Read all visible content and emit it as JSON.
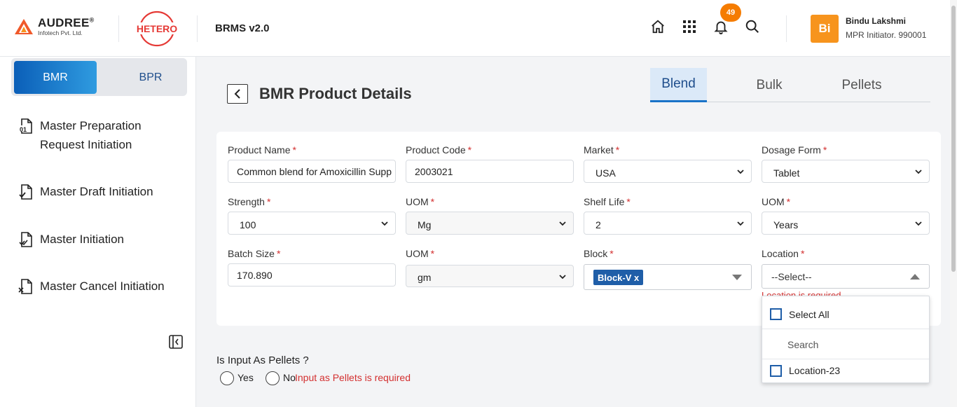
{
  "header": {
    "brand_name": "AUDREE",
    "brand_reg": "®",
    "brand_sub": "Infotech Pvt. Ltd.",
    "partner_logo": "HETERO",
    "app_title": "BRMS v2.0",
    "notification_count": "49",
    "user": {
      "initials": "Bi",
      "name": "Bindu Lakshmi",
      "role": "MPR Initiator. 990001"
    },
    "icons": [
      "home-icon",
      "apps-grid-icon",
      "bell-icon",
      "search-icon"
    ]
  },
  "sidebar": {
    "toggle": {
      "active": "BMR",
      "inactive": "BPR"
    },
    "items": [
      {
        "label_line1": "Master Preparation",
        "label_line2": "Request Initiation",
        "icon": "file-01-icon"
      },
      {
        "label": "Master Draft Initiation",
        "icon": "file-check-icon"
      },
      {
        "label": "Master Initiation",
        "icon": "file-double-check-icon"
      },
      {
        "label": "Master Cancel Initiation",
        "icon": "file-x-icon"
      }
    ]
  },
  "main": {
    "title": "BMR Product Details",
    "tabs": [
      {
        "label": "Blend",
        "active": true
      },
      {
        "label": "Bulk",
        "active": false
      },
      {
        "label": "Pellets",
        "active": false
      }
    ],
    "form": {
      "product_name": {
        "label": "Product Name",
        "value": "Common blend for Amoxicillin Supp"
      },
      "product_code": {
        "label": "Product Code",
        "value": "2003021"
      },
      "market": {
        "label": "Market",
        "value": "USA"
      },
      "dosage_form": {
        "label": "Dosage Form",
        "value": "Tablet"
      },
      "strength": {
        "label": "Strength",
        "value": "100"
      },
      "strength_uom": {
        "label": "UOM",
        "value": "Mg"
      },
      "shelf_life": {
        "label": "Shelf Life",
        "value": "2"
      },
      "shelf_uom": {
        "label": "UOM",
        "value": "Years"
      },
      "batch_size": {
        "label": "Batch Size",
        "value": "170.890"
      },
      "batch_uom": {
        "label": "UOM",
        "value": "gm"
      },
      "block": {
        "label": "Block",
        "chip": "Block-V",
        "chip_remove": "x"
      },
      "location": {
        "label": "Location",
        "placeholder": "--Select--",
        "error": "Location is required"
      }
    },
    "location_dropdown": {
      "select_all": "Select All",
      "search_placeholder": "Search",
      "options": [
        "Location-23"
      ]
    },
    "pellets": {
      "question": "Is Input As Pellets ?",
      "yes": "Yes",
      "no": "No",
      "error": "Input as Pellets is required"
    }
  },
  "colors": {
    "accent": "#1a73c8",
    "error": "#d32f2f",
    "avatar": "#f7941d",
    "badge": "#f57c00"
  }
}
